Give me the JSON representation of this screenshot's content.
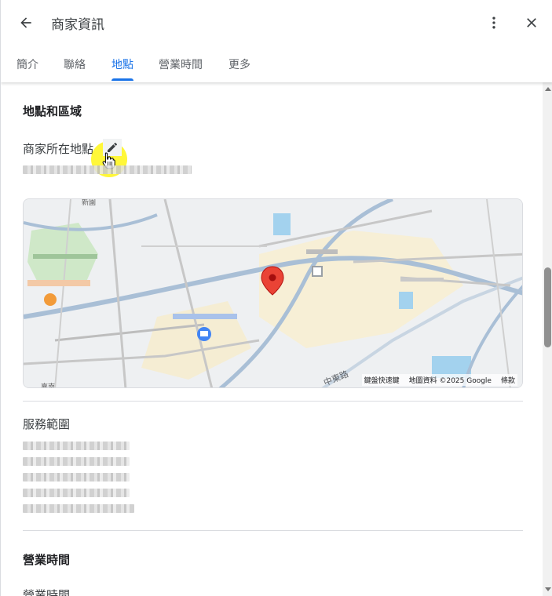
{
  "header": {
    "title": "商家資訊",
    "back_icon": "arrow-back-icon",
    "more_icon": "more-vert-icon",
    "close_icon": "close-icon"
  },
  "tabs": [
    {
      "label": "簡介",
      "active": false
    },
    {
      "label": "聯絡",
      "active": false
    },
    {
      "label": "地點",
      "active": true
    },
    {
      "label": "營業時間",
      "active": false
    },
    {
      "label": "更多",
      "active": false
    }
  ],
  "location": {
    "section_title": "地點和區域",
    "business_location_label": "商家所在地點",
    "edit_icon": "pencil-icon"
  },
  "map": {
    "attribution": {
      "shortcuts": "鍵盤快速鍵",
      "map_data": "地圖資料 ©2025 Google",
      "terms": "條款"
    },
    "labels": {
      "top_label": "新園",
      "road_label": "中東路",
      "corner_label": "嘉南"
    },
    "pin_icon": "map-pin-icon"
  },
  "service_area": {
    "label": "服務範圍"
  },
  "hours": {
    "section_title": "營業時間",
    "label": "營業時間"
  },
  "colors": {
    "accent": "#1a73e8",
    "pin": "#ea4335",
    "cursor_highlight": "#fff500"
  }
}
